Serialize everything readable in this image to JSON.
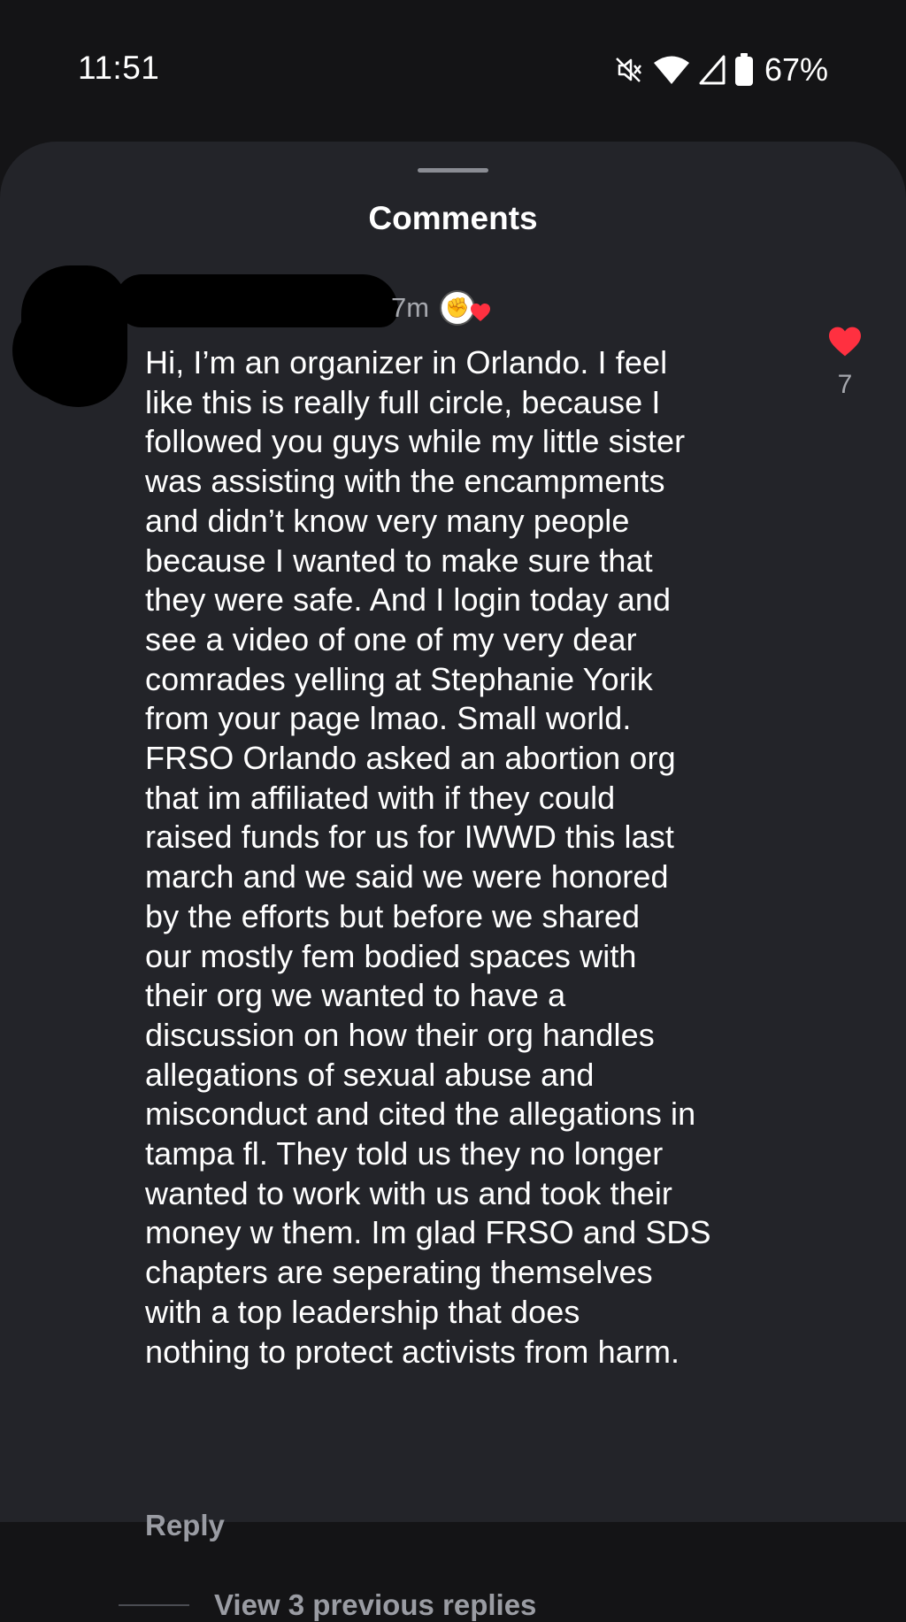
{
  "status_bar": {
    "time": "11:51",
    "battery_percent": "67%",
    "icons": [
      "mute-icon",
      "wifi-icon",
      "cellular-signal-icon",
      "battery-icon"
    ]
  },
  "sheet": {
    "title": "Comments"
  },
  "comment": {
    "timestamp": "7m",
    "text": "Hi, I’m an organizer in Orlando. I feel\nlike this is really full circle, because I\nfollowed you guys while my little sister\nwas assisting with the encampments\nand didn’t know very many people\nbecause I wanted to make sure that\nthey were safe. And I login today and\nsee a video of one of my very dear\ncomrades yelling at Stephanie Yorik\nfrom your page lmao. Small world.\nFRSO Orlando asked an abortion org\nthat im affiliated with if they could\nraised funds for us for IWWD this last\nmarch and we said we were honored\nby the efforts but before we shared\nour mostly fem bodied spaces with\ntheir org we wanted to have a\ndiscussion on how their org handles\nallegations of sexual abuse and\nmisconduct and cited the allegations in\ntampa fl. They told us they no longer\nwanted to work with us and took their\nmoney w them. Im glad FRSO and SDS\nchapters are seperating themselves\nwith a top leadership that does\nnothing to protect activists from harm.",
    "like_count": "7",
    "liked": true,
    "liked_by_creator": true,
    "reply_label": "Reply",
    "view_replies_label": "View 3 previous replies"
  },
  "colors": {
    "background": "#141416",
    "sheet": "#232429",
    "heart": "#ff3040",
    "muted_text": "#a6a8ae"
  }
}
